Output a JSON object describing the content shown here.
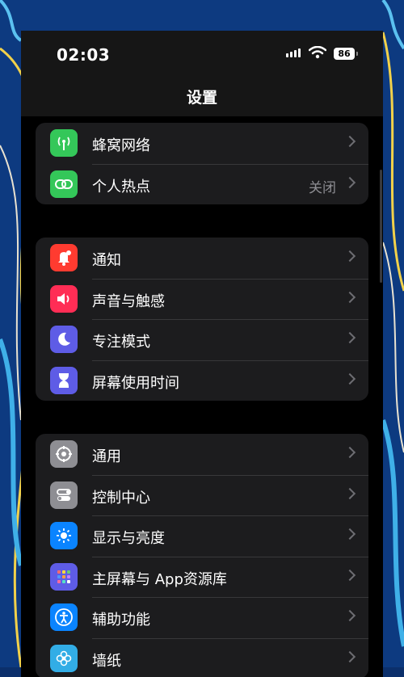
{
  "status_bar": {
    "time": "02:03",
    "battery": "86"
  },
  "nav": {
    "title": "设置"
  },
  "groups": [
    {
      "rows": [
        {
          "label": "蜂窝网络",
          "value": "",
          "icon": "antenna-icon",
          "color": "#34c759"
        },
        {
          "label": "个人热点",
          "value": "关闭",
          "icon": "link-icon",
          "color": "#34c759"
        }
      ]
    },
    {
      "rows": [
        {
          "label": "通知",
          "value": "",
          "icon": "bell-icon",
          "color": "#ff3b30"
        },
        {
          "label": "声音与触感",
          "value": "",
          "icon": "speaker-icon",
          "color": "#ff2d55"
        },
        {
          "label": "专注模式",
          "value": "",
          "icon": "moon-icon",
          "color": "#5e5ce6"
        },
        {
          "label": "屏幕使用时间",
          "value": "",
          "icon": "hourglass-icon",
          "color": "#5e5ce6"
        }
      ]
    },
    {
      "rows": [
        {
          "label": "通用",
          "value": "",
          "icon": "gear-icon",
          "color": "#8e8e93"
        },
        {
          "label": "控制中心",
          "value": "",
          "icon": "toggles-icon",
          "color": "#8e8e93"
        },
        {
          "label": "显示与亮度",
          "value": "",
          "icon": "sun-icon",
          "color": "#0a84ff"
        },
        {
          "label": "主屏幕与 App资源库",
          "value": "",
          "icon": "app-grid-icon",
          "color": "#5e5ce6"
        },
        {
          "label": "辅助功能",
          "value": "",
          "icon": "accessibility-icon",
          "color": "#0a84ff"
        },
        {
          "label": "墙纸",
          "value": "",
          "icon": "flower-icon",
          "color": "#32ade6"
        }
      ]
    }
  ]
}
